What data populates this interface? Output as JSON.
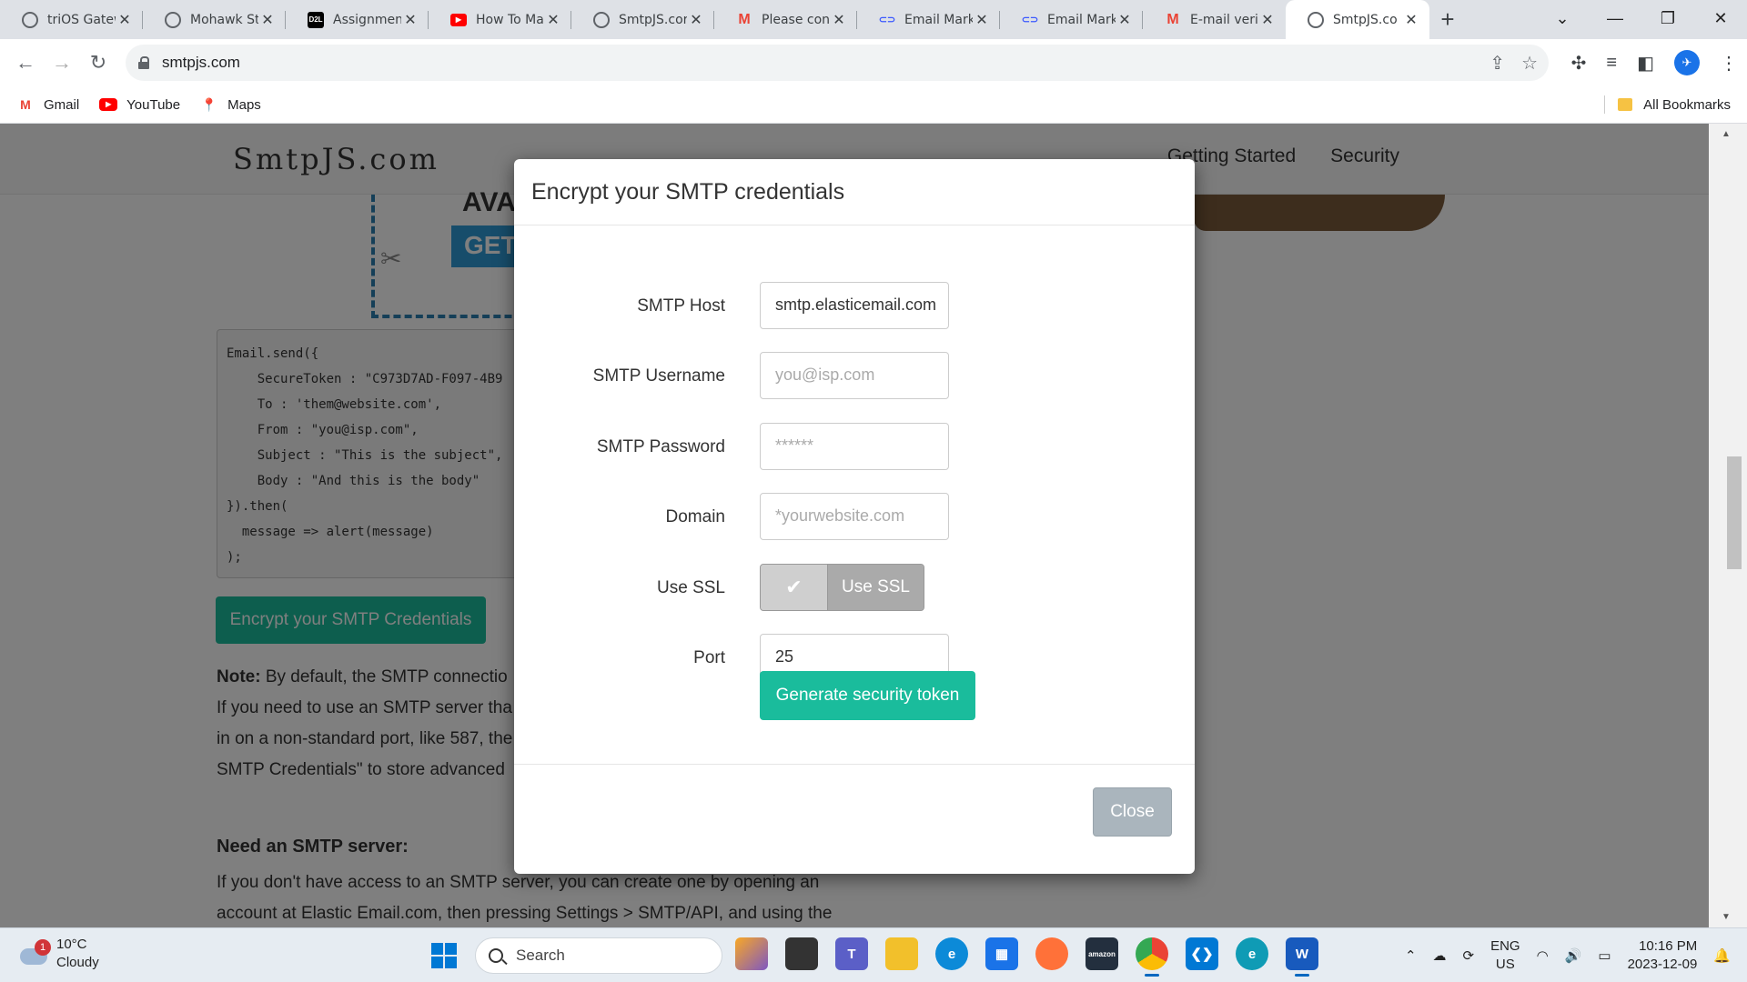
{
  "tabs": [
    {
      "title": "triOS Gatew",
      "icon": "globe-icon",
      "color": "#5f6368"
    },
    {
      "title": "Mohawk St",
      "icon": "globe-icon",
      "color": "#5f6368"
    },
    {
      "title": "Assignmen",
      "icon": "d2l-icon",
      "color": "#000000",
      "badge": "D2L"
    },
    {
      "title": "How To Ma",
      "icon": "youtube-icon",
      "color": "#ff0000"
    },
    {
      "title": "SmtpJS.cor",
      "icon": "globe-icon",
      "color": "#5f6368"
    },
    {
      "title": "Please con",
      "icon": "gmail-icon",
      "color": "#ea4335"
    },
    {
      "title": "Email Mark",
      "icon": "link-icon",
      "color": "#3d5afe"
    },
    {
      "title": "Email Mark",
      "icon": "link-icon",
      "color": "#3d5afe"
    },
    {
      "title": "E-mail veri",
      "icon": "gmail-icon",
      "color": "#ea4335"
    },
    {
      "title": "SmtpJS.co",
      "icon": "globe-icon",
      "color": "#5f6368",
      "active": true
    }
  ],
  "address": {
    "url": "smtpjs.com"
  },
  "bookmarks": {
    "items": [
      {
        "label": "Gmail",
        "icon": "gmail-icon"
      },
      {
        "label": "YouTube",
        "icon": "youtube-icon"
      },
      {
        "label": "Maps",
        "icon": "maps-icon"
      }
    ],
    "all_label": "All Bookmarks"
  },
  "site": {
    "brand": "SmtpJS.com",
    "nav": [
      "Getting Started",
      "Security"
    ],
    "banner_get": "GET",
    "banner_ava": "AVA",
    "code": "Email.send({\n    SecureToken : \"C973D7AD-F097-4B9\n    To : 'them@website.com',\n    From : \"you@isp.com\",\n    Subject : \"This is the subject\",\n    Body : \"And this is the body\"\n}).then(\n  message => alert(message)\n);",
    "encrypt_button": "Encrypt your SMTP Credentials",
    "note_label": "Note:",
    "note_text": " By default, the SMTP connectio",
    "note_lines": [
      "If you need to use an SMTP server tha",
      "in on a non-standard port, like 587, the",
      "SMTP Credentials\" to store advanced"
    ],
    "need_heading": "Need an SMTP server:",
    "need_lines": [
      "If you don't have access to an SMTP server, you can create one by opening an",
      "account at Elastic Email.com, then pressing Settings > SMTP/API, and using the"
    ]
  },
  "modal": {
    "title": "Encrypt your SMTP credentials",
    "fields": {
      "host_label": "SMTP Host",
      "host_value": "smtp.elasticemail.com",
      "username_label": "SMTP Username",
      "username_placeholder": "you@isp.com",
      "password_label": "SMTP Password",
      "password_placeholder": "******",
      "domain_label": "Domain",
      "domain_placeholder": "*yourwebsite.com",
      "ssl_label": "Use SSL",
      "ssl_toggle_label": "Use SSL",
      "port_label": "Port",
      "port_value": "25"
    },
    "generate_button": "Generate security token",
    "close_button": "Close"
  },
  "taskbar": {
    "weather_badge": "1",
    "weather_temp": "10°C",
    "weather_cond": "Cloudy",
    "search_label": "Search",
    "lang_top": "ENG",
    "lang_bottom": "US",
    "time": "10:16 PM",
    "date": "2023-12-09"
  }
}
